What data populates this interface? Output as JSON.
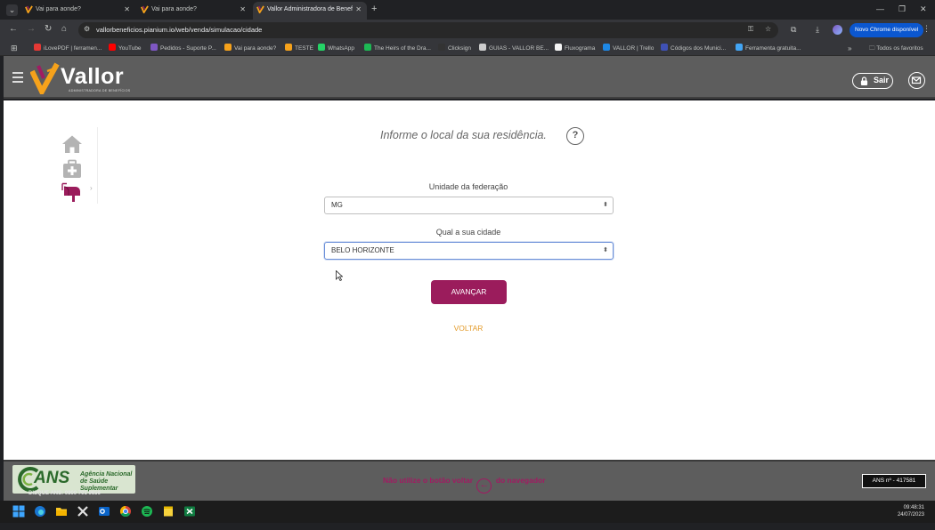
{
  "browser": {
    "tabs": [
      {
        "title": "Vai para aonde?",
        "active": false
      },
      {
        "title": "Vai para aonde?",
        "active": false
      },
      {
        "title": "Vallor Administradora de Benef",
        "active": true
      }
    ],
    "url": "vallorbeneficios.pianium.io/web/venda/simulacao/cidade",
    "update_button": "Novo Chrome disponível",
    "bookmarks": [
      {
        "label": "iLovePDF | ferramen...",
        "color": "#e53935"
      },
      {
        "label": "YouTube",
        "color": "#ff0000"
      },
      {
        "label": "Pedidos - Suporte P...",
        "color": "#7e57c2"
      },
      {
        "label": "Vai para aonde?",
        "color": "#f6a21b"
      },
      {
        "label": "TESTE",
        "color": "#f6a21b"
      },
      {
        "label": "WhatsApp",
        "color": "#25d366"
      },
      {
        "label": "The Heirs of the Dra...",
        "color": "#1db954"
      },
      {
        "label": "Clicksign",
        "color": "#333333"
      },
      {
        "label": "GUIAS - VALLOR BE...",
        "color": "#cccccc"
      },
      {
        "label": "Fluxograma",
        "color": "#f5f5f5"
      },
      {
        "label": "VALLOR | Trello",
        "color": "#1e88e5"
      },
      {
        "label": "Códigos dos Munici...",
        "color": "#3f51b5"
      },
      {
        "label": "Ferramenta gratuita...",
        "color": "#42a5f5"
      }
    ],
    "all_bookmarks": "Todos os favoritos"
  },
  "header": {
    "brand": "Vallor",
    "brand_sub": "ADMINISTRADORA DE BENEFÍCIOS",
    "logout_label": "Sair",
    "brand_color": "#f6a21b"
  },
  "form": {
    "prompt": "Informe o local da sua residência.",
    "help_label": "?",
    "uf_label": "Unidade da federação",
    "uf_value": "MG",
    "city_label": "Qual a sua cidade",
    "city_value": "BELO HORIZONTE",
    "submit_label": "AVANÇAR",
    "back_label": "VOLTAR",
    "accent_color": "#9b1c5c"
  },
  "footer": {
    "ans_brand": "ANS",
    "ans_agency": "Agência Nacional de Saúde Suplementar",
    "ans_phone": "DISQUE ANS: 0800 701 9656",
    "warning_before": "Não utilize o botão voltar",
    "warning_after": "do navegador",
    "ans_registration": "ANS nº - 417581"
  },
  "taskbar": {
    "time": "09:48:31",
    "date": "24/07/2023"
  }
}
